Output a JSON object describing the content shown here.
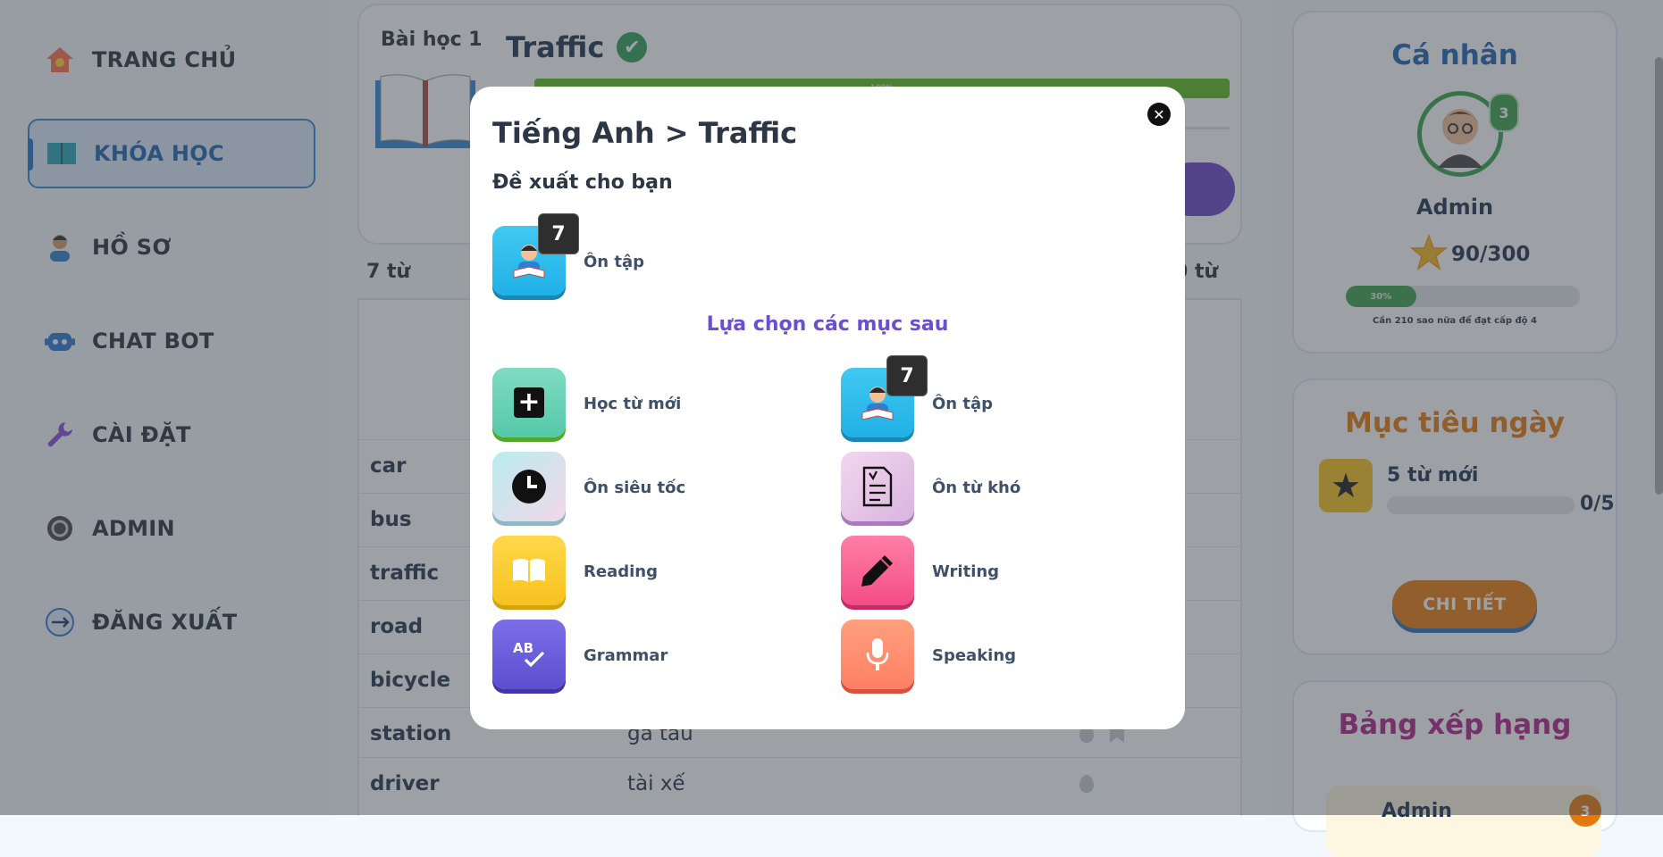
{
  "sidebar": {
    "items": [
      {
        "label": "TRANG CHỦ",
        "icon": "home-icon"
      },
      {
        "label": "KHÓA HỌC",
        "icon": "book-icon",
        "active": true
      },
      {
        "label": "HỒ SƠ",
        "icon": "person-icon"
      },
      {
        "label": "CHAT BOT",
        "icon": "robot-icon"
      },
      {
        "label": "CÀI ĐẶT",
        "icon": "wrench-icon"
      },
      {
        "label": "ADMIN",
        "icon": "admin-icon"
      },
      {
        "label": "ĐĂNG XUẤT",
        "icon": "logout-icon"
      }
    ]
  },
  "lesson": {
    "number_label": "Bài học 1",
    "title": "Traffic",
    "progress_label": "100%",
    "progress": 1.0,
    "word_count_left": "7 từ",
    "word_count_right": "0 từ",
    "words": [
      {
        "word": "car",
        "meaning": ""
      },
      {
        "word": "bus",
        "meaning": ""
      },
      {
        "word": "traffic",
        "meaning": ""
      },
      {
        "word": "road",
        "meaning": ""
      },
      {
        "word": "bicycle",
        "meaning": ""
      },
      {
        "word": "station",
        "meaning": "ga tàu"
      },
      {
        "word": "driver",
        "meaning": "tài xế"
      }
    ]
  },
  "profile": {
    "title": "Cá nhân",
    "level": "3",
    "name": "Admin",
    "stars": "90/300",
    "progress_label": "30%",
    "progress": 0.3,
    "hint": "Cần 210 sao nữa để đạt cấp độ 4"
  },
  "daily_goal": {
    "title": "Mục tiêu ngày",
    "goal_text": "5 từ mới",
    "count": "0/5",
    "progress": 0,
    "button": "CHI TIẾT"
  },
  "leaderboard": {
    "title": "Bảng xếp hạng",
    "first_name": "Admin",
    "first_rank": "3"
  },
  "modal": {
    "breadcrumb": "Tiếng Anh > Traffic",
    "suggest_heading": "Đề xuất cho bạn",
    "suggest_item": {
      "label": "Ôn tập",
      "badge": "7"
    },
    "choose_heading": "Lựa chọn các mục sau",
    "options": [
      {
        "label": "Học từ mới",
        "icon": "plus-icon"
      },
      {
        "label": "Ôn tập",
        "icon": "student-icon",
        "badge": "7"
      },
      {
        "label": "Ôn siêu tốc",
        "icon": "clock-icon"
      },
      {
        "label": "Ôn từ khó",
        "icon": "note-icon"
      },
      {
        "label": "Reading",
        "icon": "book-open-icon"
      },
      {
        "label": "Writing",
        "icon": "pencil-icon"
      },
      {
        "label": "Grammar",
        "icon": "grammar-check-icon"
      },
      {
        "label": "Speaking",
        "icon": "microphone-icon"
      }
    ]
  }
}
